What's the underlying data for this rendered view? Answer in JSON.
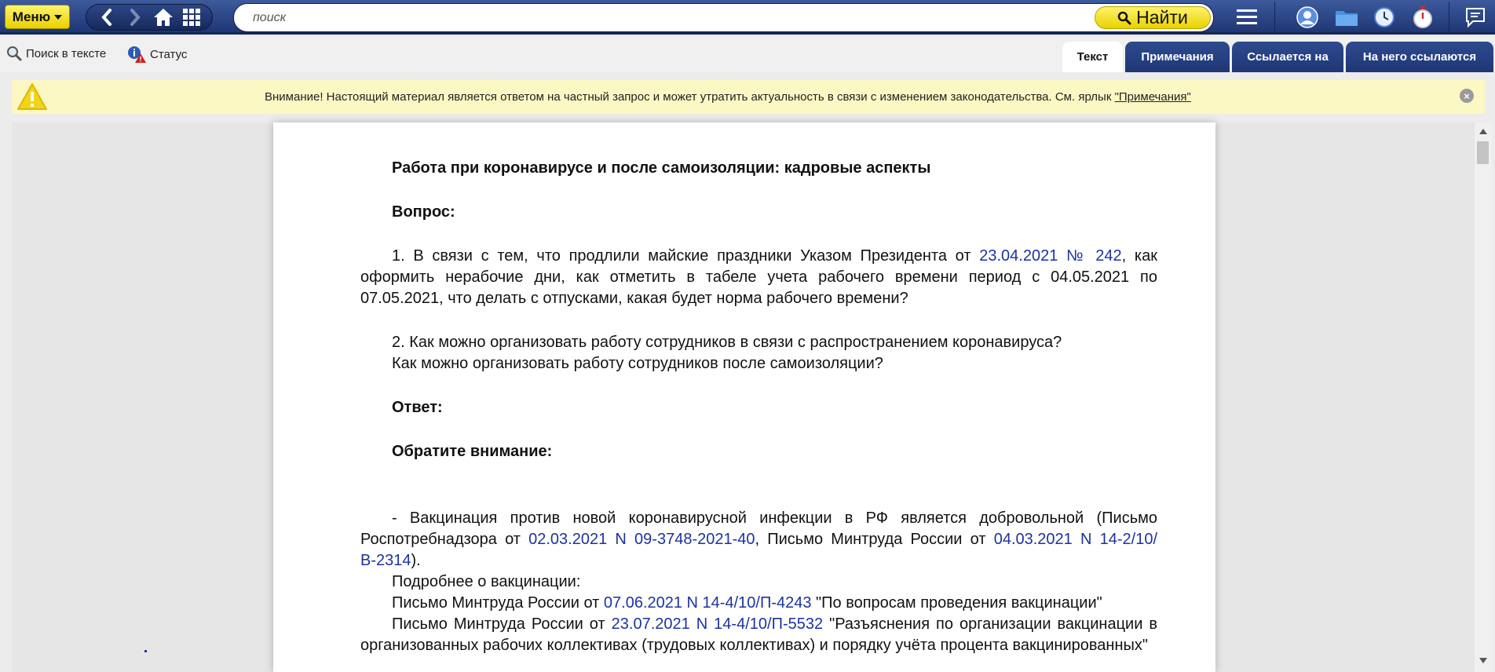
{
  "topbar": {
    "menu_label": "Меню",
    "search_placeholder": "поиск",
    "find_label": "Найти"
  },
  "toolbar": {
    "search_in_text": "Поиск в тексте",
    "status": "Статус"
  },
  "tabs": [
    {
      "label": "Текст"
    },
    {
      "label": "Примечания"
    },
    {
      "label": "Ссылается на"
    },
    {
      "label": "На него ссылаются"
    }
  ],
  "warning": {
    "text": "Внимание! Настоящий материал является ответом на частный запрос и может утратить актуальность в связи с изменением законодательства. См. ярлык ",
    "link": "\"Примечания\""
  },
  "document": {
    "title": "Работа при коронавирусе и после самоизоляции: кадровые аспекты",
    "question_heading": "Вопрос:",
    "q1_a": "1. В связи с тем, что продлили майские праздники Указом Президента от ",
    "q1_link": "23.04.2021 № 242",
    "q1_b": ", как оформить нерабочие дни, как отметить в табеле учета рабочего времени период с 04.05.2021 по 07.05.2021, что делать с отпусками, какая будет норма рабочего времени?",
    "q2_a": "2. Как можно организовать работу сотрудников в связи с распространением коронавируса?",
    "q2_b": "Как можно организовать работу сотрудников после самоизоляции?",
    "answer_heading": "Ответ:",
    "attention_heading": "Обратите внимание:",
    "vac_a": "- Вакцинация против новой коронавирусной инфекции в РФ является добровольной (Письмо Роспотребнадзора от ",
    "vac_link1": "02.03.2021 N 09-3748-2021-40",
    "vac_b": ", Письмо Минтруда России от ",
    "vac_link2": "04.03.2021 N 14-2/10/В-2314",
    "vac_c": ").",
    "more": "Подробнее о вакцинации:",
    "l1_a": "Письмо Минтруда России от ",
    "l1_link": "07.06.2021 N 14-4/10/П-4243",
    "l1_b": " \"По вопросам проведения вакцинации\"",
    "l2_a": "Письмо Минтруда России от ",
    "l2_link": "23.07.2021 N 14-4/10/П-5532",
    "l2_b": " \"Разъяснения по организации вакцинации в организованных рабочих коллективах (трудовых коллективах) и порядку учёта процента вакцинированных\""
  }
}
